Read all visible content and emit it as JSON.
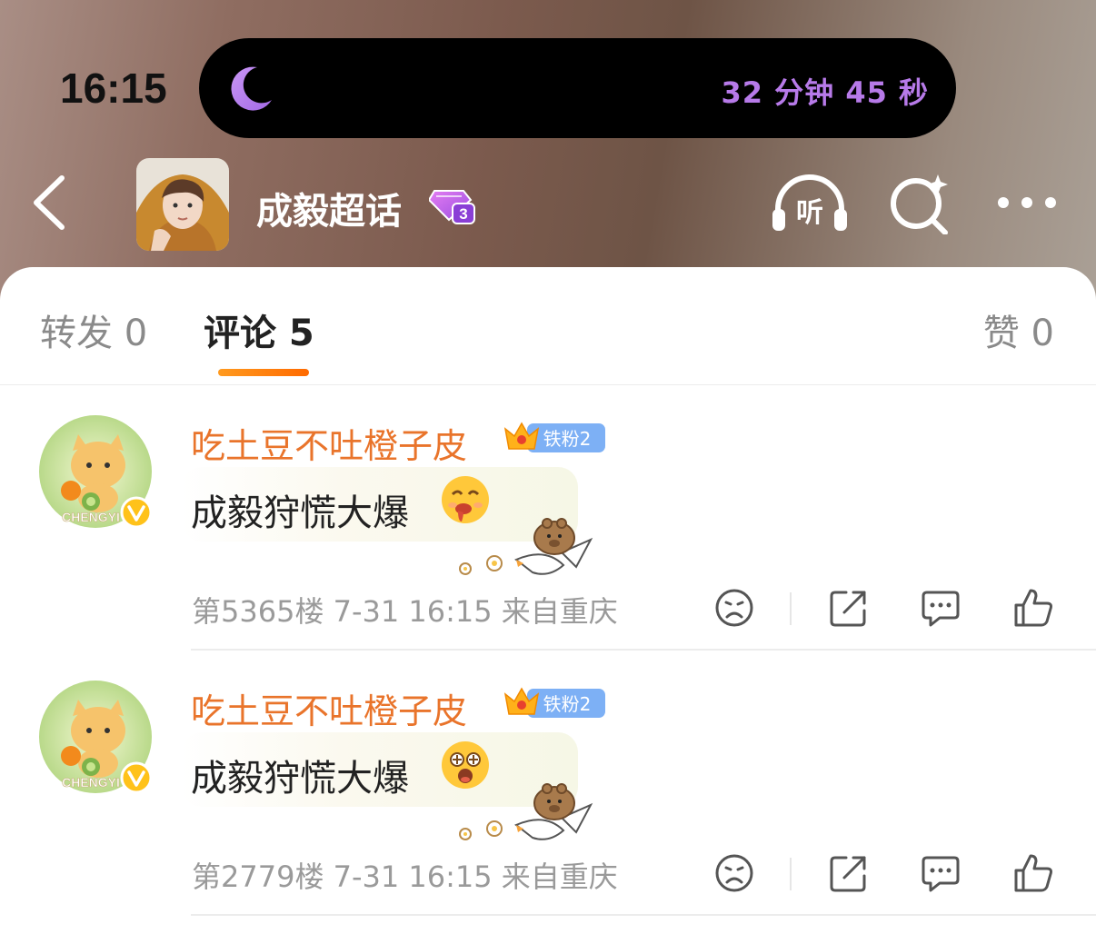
{
  "status_bar": {
    "time": "16:15",
    "sleep_timer": "32 分钟 45 秒"
  },
  "nav": {
    "title": "成毅超话",
    "level_badge": "3",
    "listen_label": "听"
  },
  "tabs": [
    {
      "label": "转发 0"
    },
    {
      "label": "评论 5"
    },
    {
      "label": "赞 0"
    }
  ],
  "comments": [
    {
      "author": "吃土豆不吐橙子皮",
      "fan_badge": "铁粉2",
      "avatar_text": "CHENGYI",
      "text": "成毅狩慌大爆",
      "meta": "第5365楼  7-31 16:15  来自重庆"
    },
    {
      "author": "吃土豆不吐橙子皮",
      "fan_badge": "铁粉2",
      "avatar_text": "CHENGYI",
      "text": "成毅狩慌大爆",
      "meta": "第2779楼  7-31 16:15  来自重庆"
    }
  ],
  "colors": {
    "accent_orange": "#ff7a00",
    "author_orange": "#e9742b",
    "timer_purple": "#b77ae9"
  }
}
